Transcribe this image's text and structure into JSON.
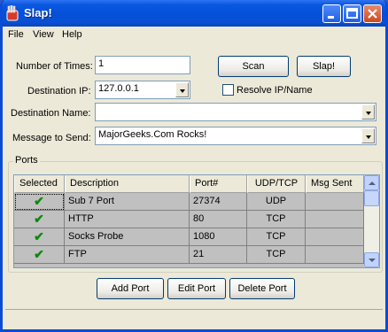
{
  "window": {
    "title": "Slap!"
  },
  "menu": [
    "File",
    "View",
    "Help"
  ],
  "form": {
    "times_label": "Number of Times:",
    "times_value": "1",
    "dest_ip_label": "Destination IP:",
    "dest_ip_value": "127.0.0.1",
    "resolve_label": "Resolve IP/Name",
    "resolve_checked": false,
    "dest_name_label": "Destination Name:",
    "dest_name_value": "",
    "message_label": "Message to Send:",
    "message_value": "MajorGeeks.Com Rocks!"
  },
  "buttons": {
    "scan": "Scan",
    "slap": "Slap!",
    "add_port": "Add Port",
    "edit_port": "Edit Port",
    "delete_port": "Delete Port"
  },
  "ports": {
    "group_title": "Ports",
    "columns": [
      "Selected",
      "Description",
      "Port#",
      "UDP/TCP",
      "Msg Sent"
    ],
    "rows": [
      {
        "selected": "✔",
        "description": "Sub 7 Port",
        "port": "27374",
        "protocol": "UDP",
        "msg_sent": ""
      },
      {
        "selected": "✔",
        "description": "HTTP",
        "port": "80",
        "protocol": "TCP",
        "msg_sent": ""
      },
      {
        "selected": "✔",
        "description": "Socks Probe",
        "port": "1080",
        "protocol": "TCP",
        "msg_sent": ""
      },
      {
        "selected": "✔",
        "description": "FTP",
        "port": "21",
        "protocol": "TCP",
        "msg_sent": ""
      }
    ]
  },
  "colors": {
    "titlebar": "#0a58e0",
    "face": "#ece9d8",
    "list_bg": "#c0c0c0",
    "check": "#0a8a0a"
  }
}
